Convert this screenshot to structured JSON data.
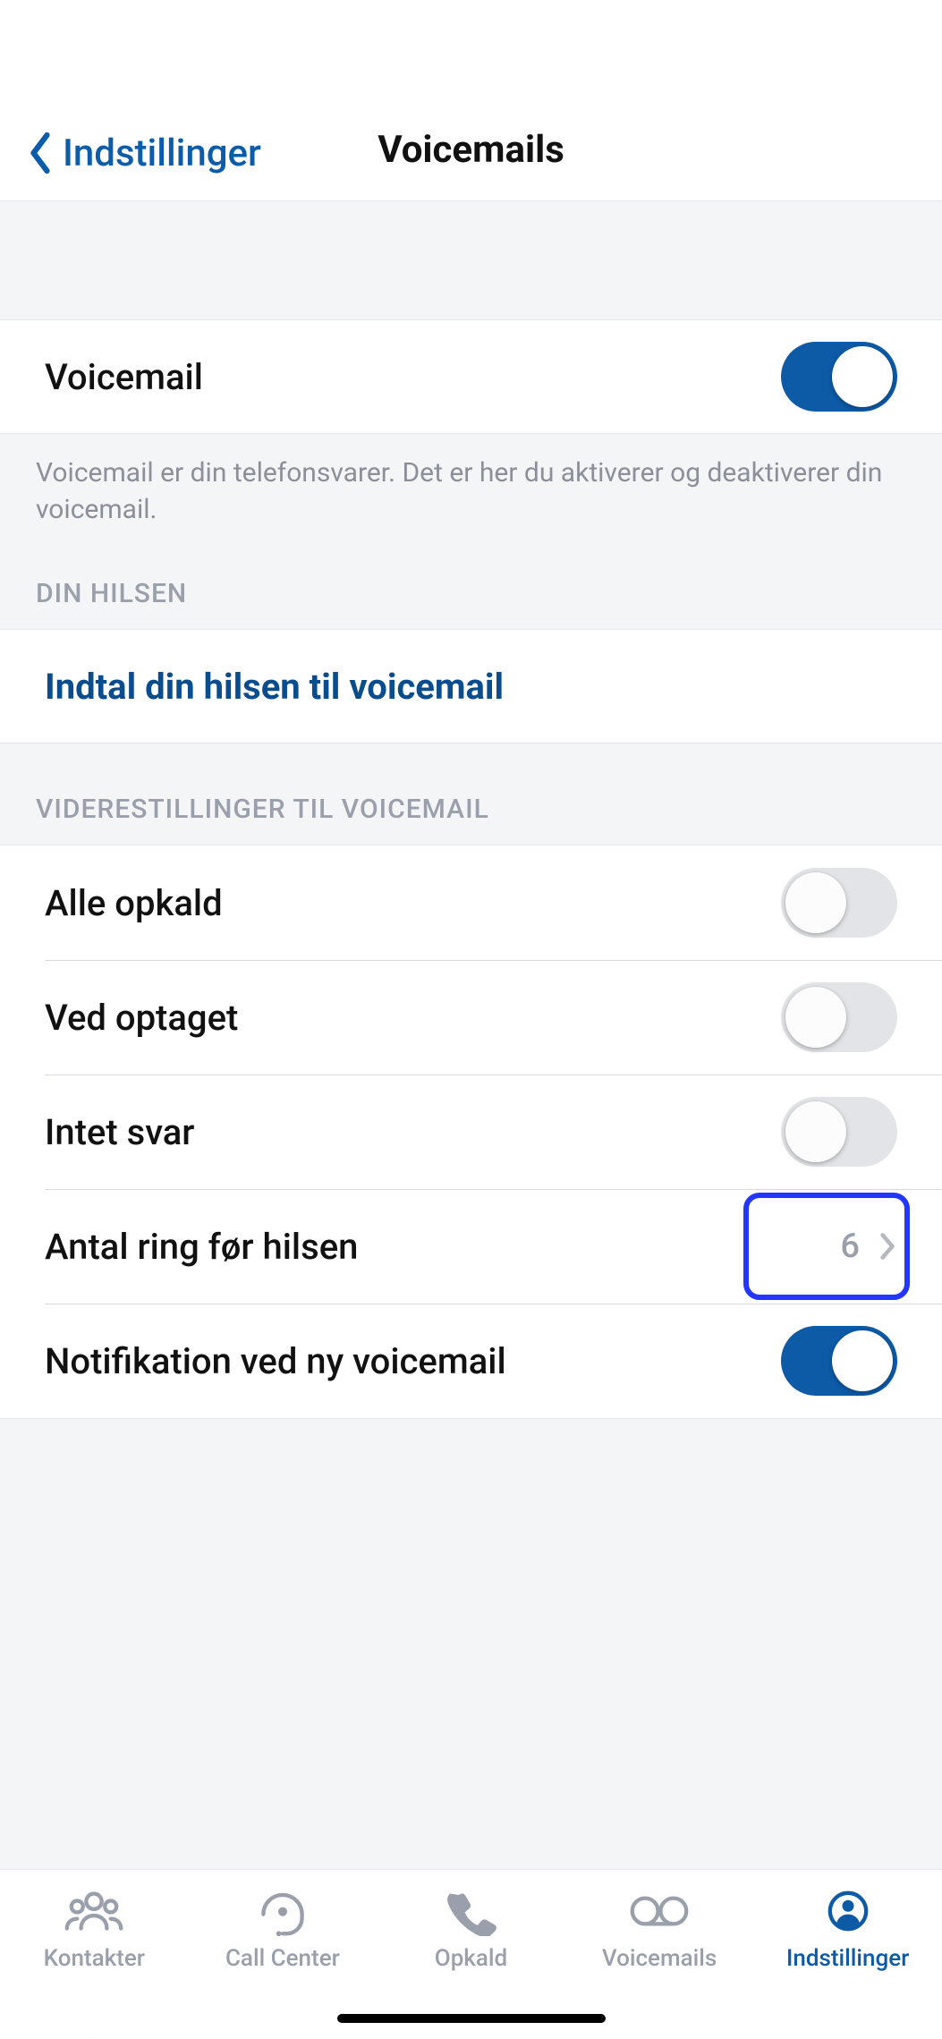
{
  "header": {
    "back_label": "Indstillinger",
    "title": "Voicemails"
  },
  "voicemail": {
    "label": "Voicemail",
    "enabled": true,
    "description": "Voicemail er din telefonsvarer. Det er her du aktiverer og deaktiverer din voicemail."
  },
  "greeting": {
    "section": "DIN HILSEN",
    "record_label": "Indtal din hilsen til voicemail"
  },
  "forwarding": {
    "section": "VIDERESTILLINGER TIL VOICEMAIL",
    "rows": {
      "all_calls": {
        "label": "Alle opkald",
        "enabled": false
      },
      "busy": {
        "label": "Ved optaget",
        "enabled": false
      },
      "no_answer": {
        "label": "Intet svar",
        "enabled": false
      },
      "rings": {
        "label": "Antal ring før hilsen",
        "value": "6",
        "highlighted": true
      },
      "notify": {
        "label": "Notifikation ved ny voicemail",
        "enabled": true
      }
    }
  },
  "tabs": {
    "contacts": "Kontakter",
    "callcenter": "Call Center",
    "calls": "Opkald",
    "voicemails": "Voicemails",
    "settings": "Indstillinger",
    "active": "settings"
  }
}
